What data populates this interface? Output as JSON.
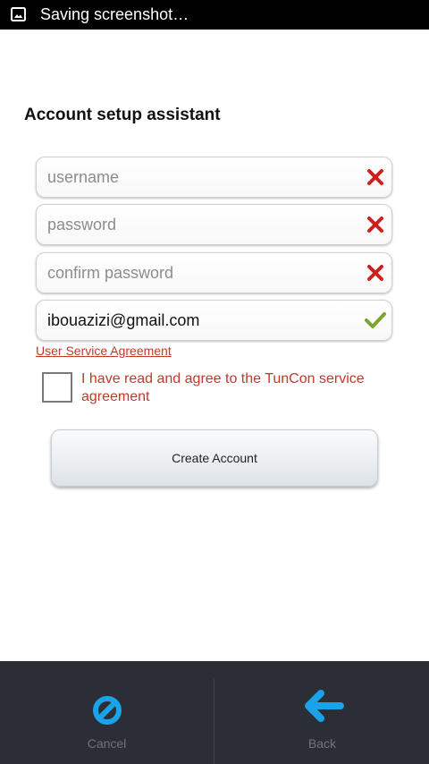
{
  "status_bar": {
    "icon": "image-icon",
    "text": "Saving screenshot…"
  },
  "title": "Account setup assistant",
  "fields": [
    {
      "name": "username",
      "placeholder": "username",
      "value": "",
      "status": "invalid"
    },
    {
      "name": "password",
      "placeholder": "password",
      "value": "",
      "status": "invalid"
    },
    {
      "name": "confirm_password",
      "placeholder": "confirm password",
      "value": "",
      "status": "invalid"
    },
    {
      "name": "email",
      "placeholder": "",
      "value": "ibouazizi@gmail.com",
      "status": "valid"
    }
  ],
  "agreement_link": "User Service Agreement",
  "agree_checkbox": {
    "checked": false,
    "label": "I have read and agree to the TunCon service agreement"
  },
  "create_button": "Create Account",
  "bottom_bar": {
    "cancel": {
      "label": "Cancel",
      "icon": "cancel-icon"
    },
    "back": {
      "label": "Back",
      "icon": "back-arrow-icon"
    }
  },
  "colors": {
    "error": "#cc1f1f",
    "success": "#7aa533",
    "accent": "#1aa3e8",
    "link": "#c0392b"
  }
}
